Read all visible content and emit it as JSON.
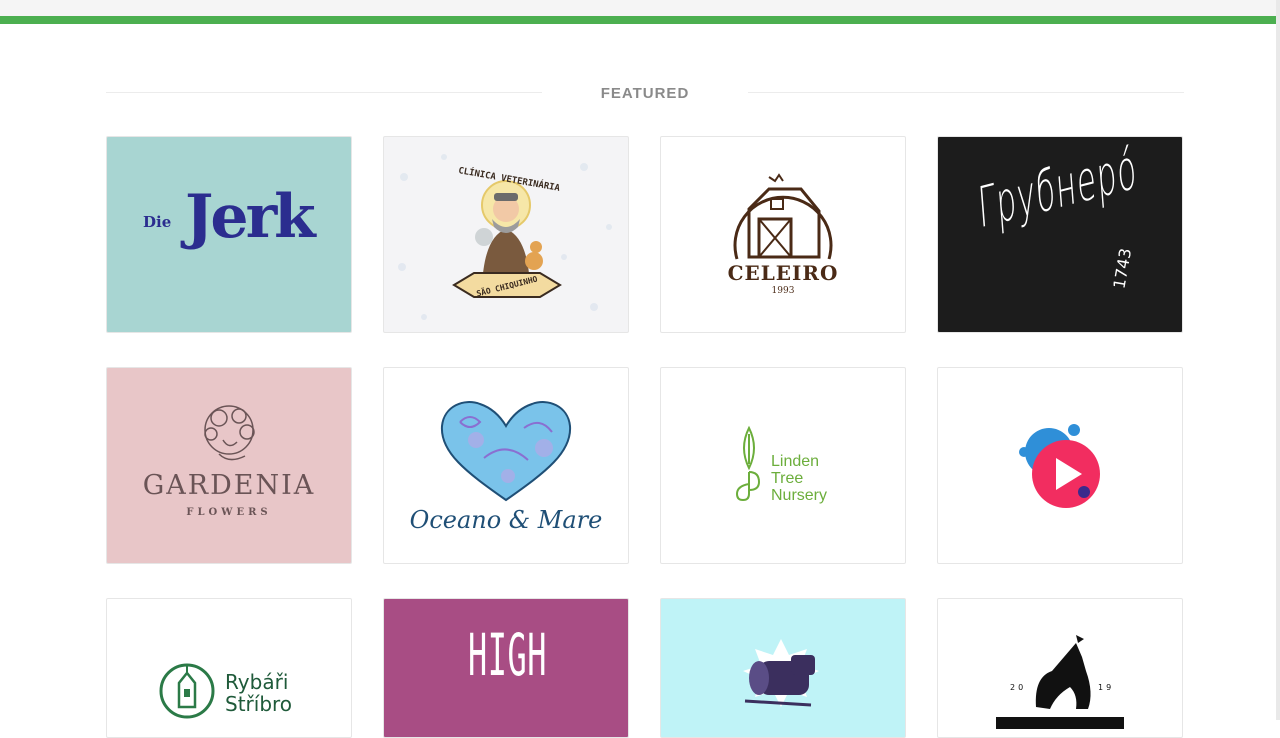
{
  "section": {
    "title": "FEATURED"
  },
  "logos": {
    "die_jerk": {
      "small": "Die",
      "big": "Jerk"
    },
    "clinica": {
      "arc": "CLÍNICA VETERINÁRIA",
      "ribbon": "SÃO CHIQUINHO"
    },
    "celeiro": {
      "name": "CELEIRO",
      "year": "1993"
    },
    "grubnero": {
      "name": "Грубнерó",
      "year": "1743"
    },
    "gardenia": {
      "name": "GARDENIA",
      "sub": "FLOWERS"
    },
    "oceano": {
      "name": "Oceano & Mare"
    },
    "linden": {
      "line1": "Linden",
      "line2": "Tree",
      "line3": "Nursery"
    },
    "play": {},
    "rybari": {
      "line1": "Rybáři",
      "line2": "Stříbro"
    },
    "high": {
      "name": "HIGH"
    },
    "log": {},
    "alpaca": {
      "left": "20",
      "right": "19"
    }
  },
  "colors": {
    "accent_green": "#4caf50",
    "mint": "#a8d5d2",
    "navy": "#2b2d8f",
    "pink_bg": "#e8c6c8",
    "magenta_bg": "#a84d84",
    "sky_bg": "#bff3f7"
  }
}
